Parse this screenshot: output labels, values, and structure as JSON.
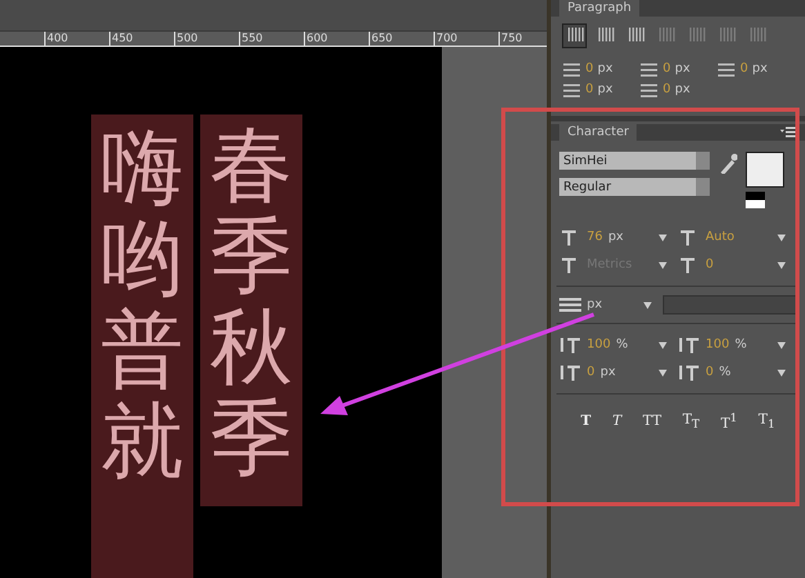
{
  "ruler": {
    "ticks": [
      "400",
      "450",
      "500",
      "550",
      "600",
      "650",
      "700",
      "750"
    ]
  },
  "canvas": {
    "columns": [
      {
        "text": "嗨哟普就"
      },
      {
        "text": "春季秋季"
      }
    ]
  },
  "paragraph_panel": {
    "title": "Paragraph",
    "align_buttons": [
      {
        "selected": true
      },
      {
        "selected": false
      },
      {
        "selected": false
      },
      {
        "selected": false
      },
      {
        "selected": false
      },
      {
        "selected": false
      },
      {
        "selected": false
      }
    ],
    "fields": [
      {
        "value": "0",
        "unit": "px"
      },
      {
        "value": "0",
        "unit": "px"
      },
      {
        "value": "0",
        "unit": "px"
      },
      {
        "value": "0",
        "unit": "px"
      },
      {
        "value": "0",
        "unit": "px"
      }
    ]
  },
  "character_panel": {
    "title": "Character",
    "font_family": "SimHei",
    "font_style": "Regular",
    "rows": [
      {
        "value": "76",
        "unit": "px",
        "disabled": false
      },
      {
        "value": "Auto",
        "unit": "",
        "disabled": false
      },
      {
        "value": "Metrics",
        "unit": "",
        "disabled": true
      },
      {
        "value": "0",
        "unit": "",
        "disabled": false
      }
    ],
    "leading_unit": "px",
    "scale_rows": [
      {
        "value": "100",
        "unit": "%"
      },
      {
        "value": "100",
        "unit": "%"
      },
      {
        "value": "0",
        "unit": "px"
      },
      {
        "value": "0",
        "unit": "%"
      }
    ],
    "style_buttons": [
      {
        "kind": "bold",
        "label": "T"
      },
      {
        "kind": "italic",
        "label": "T"
      },
      {
        "kind": "caps",
        "label": "TT"
      },
      {
        "kind": "smallcaps",
        "label": "T$_{T}$"
      },
      {
        "kind": "super",
        "label": "T$^{1}$"
      },
      {
        "kind": "sub",
        "label": "T$_{1}$"
      }
    ]
  }
}
